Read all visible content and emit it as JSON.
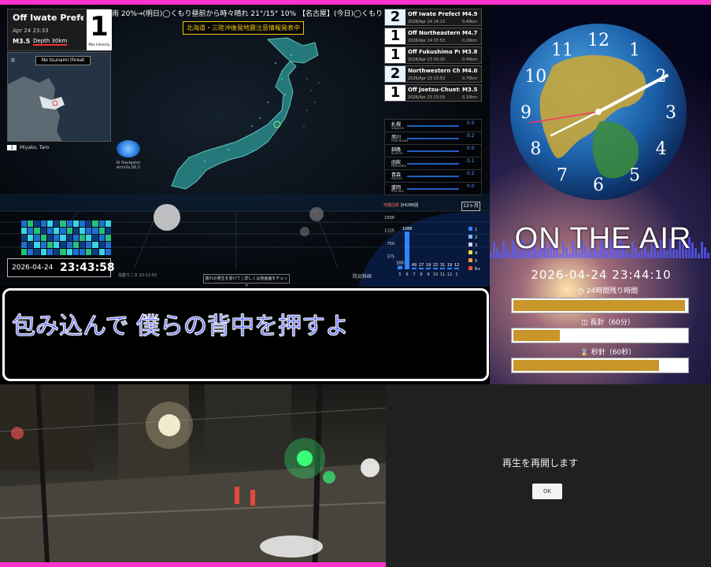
{
  "ticker": "雨 20%→(明日)◯くもり昼前から時々晴れ 21°/15° 10% 【名古屋】(今日)◯くもり 10%→(明日)◯くもり",
  "warning_banner": "北海道・三陸沖後発地震注意情報発表中",
  "current_quake": {
    "name": "Off Iwate Prefe",
    "time": "Apr 24 23:33",
    "magnitude": "M3.5",
    "depth": "Depth 30km",
    "intensity": "1",
    "intensity_label": "Max Intensity",
    "tsunami": "No tsunami threat",
    "map_tag": "震",
    "station_badge": "1",
    "station": "Miyako, Taro"
  },
  "navigator": {
    "name": "AI Navigator",
    "version": "Armilla β6.5"
  },
  "digital_clock": {
    "date": "2026-04-24",
    "time": "23:43:58"
  },
  "quake_list": [
    {
      "intensity": "2",
      "name": "Off Iwate Prefectur",
      "time": "2026/Apr 24 14:13",
      "magnitude": "M4.9",
      "depth": "0.40km"
    },
    {
      "intensity": "1",
      "name": "Off Northeastern A",
      "time": "2026/Apr 24 07:53",
      "magnitude": "M4.7",
      "depth": "0.20km"
    },
    {
      "intensity": "1",
      "name": "Off Fukushima Pre",
      "time": "2026/Apr 23 03:30",
      "magnitude": "M3.8",
      "depth": "0.40km"
    },
    {
      "intensity": "2",
      "name": "Northwestern Chib",
      "time": "2026/Apr 23 23:53",
      "magnitude": "M4.0",
      "depth": "0.70km"
    },
    {
      "intensity": "1",
      "name": "Off Joetsu-Chuetsu",
      "time": "2026/Apr 23 23:39",
      "magnitude": "M3.5",
      "depth": "0.10km"
    }
  ],
  "regions": [
    {
      "name": "札幌",
      "sub": "Sapporo",
      "value": "0.0"
    },
    {
      "name": "旭川",
      "sub": "Asahikawa",
      "value": "0.2"
    },
    {
      "name": "釧路",
      "sub": "Kushiro",
      "value": "0.0"
    },
    {
      "name": "函館",
      "sub": "Hakodate",
      "value": "0.1"
    },
    {
      "name": "青森",
      "sub": "Aomori",
      "value": "0.2"
    },
    {
      "name": "盛岡",
      "sub": "Morioka",
      "value": "0.0"
    }
  ],
  "histogram": {
    "title": "地震回数",
    "total": "計4285回",
    "range_button": "12ヶ月",
    "y_ticks": [
      "1500",
      "1125",
      "750",
      "375"
    ],
    "legend": [
      "1",
      "2",
      "3",
      "4",
      "5",
      "6+"
    ],
    "values": [
      100,
      1088,
      49,
      27,
      19,
      22,
      31,
      19,
      12
    ],
    "x_labels": [
      "5",
      "6",
      "7",
      "8",
      "9",
      "10",
      "11",
      "12",
      "1"
    ]
  },
  "depth_scale": [
    "0km",
    "25km",
    "50km",
    "100km",
    "150km",
    "200km"
  ],
  "eq_note": "揺れの発生を受けて | 詳しくは他画面をチェック",
  "eq_credit": "強震モニタ 23:13:50",
  "nied": "防災科研",
  "subtitle": "包み込んで 僕らの背中を押すよ",
  "air": {
    "clock_numbers": [
      "12",
      "1",
      "2",
      "3",
      "4",
      "5",
      "6",
      "7",
      "8",
      "9",
      "10",
      "11"
    ],
    "on_air": "ON THE AIR",
    "datetime": "2026-04-24 23:44:10",
    "bars": [
      {
        "label": "24時間残り時間",
        "value": 0.99
      },
      {
        "label": "長針（60分）",
        "value": 0.27
      },
      {
        "label": "秒針（60秒）",
        "value": 0.84
      }
    ]
  },
  "video": {
    "message": "再生を再開します",
    "ok_label": "OK"
  },
  "colors": {
    "frame": "#ff33cc",
    "subtitle_text": "#4a5cff",
    "bar_fill": "#c8962a",
    "warning": "#f5c400"
  }
}
